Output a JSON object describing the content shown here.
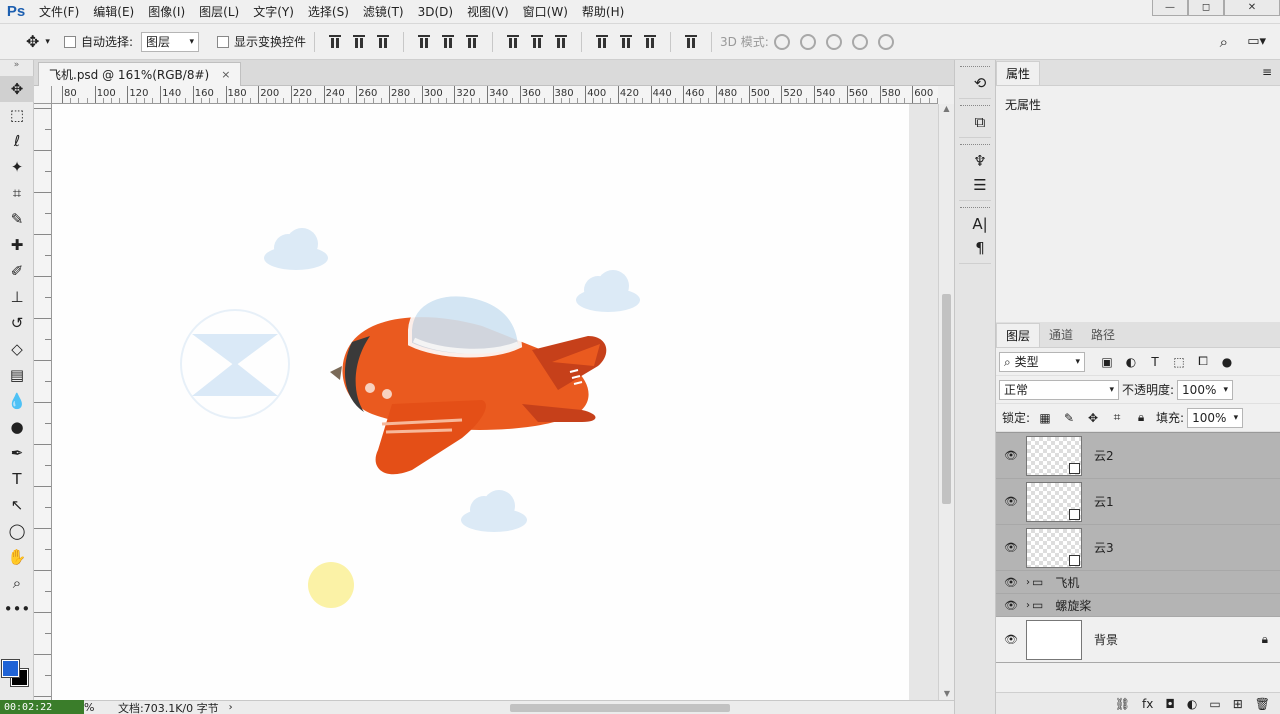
{
  "app": {
    "logo": "Ps"
  },
  "menu": [
    "文件(F)",
    "编辑(E)",
    "图像(I)",
    "图层(L)",
    "文字(Y)",
    "选择(S)",
    "滤镜(T)",
    "3D(D)",
    "视图(V)",
    "窗口(W)",
    "帮助(H)"
  ],
  "window_controls": {
    "minimize": "—",
    "maximize": "◻",
    "close": "✕"
  },
  "options": {
    "auto_select_label": "自动选择:",
    "auto_select_value": "图层",
    "show_transform_label": "显示变换控件",
    "mode_3d_label": "3D 模式:"
  },
  "document": {
    "tab_title": "飞机.psd @ 161%(RGB/8#)",
    "close_glyph": "×"
  },
  "ruler": {
    "h_labels": [
      "80",
      "100",
      "120",
      "140",
      "160",
      "180",
      "200",
      "220",
      "240",
      "260",
      "280",
      "300",
      "320",
      "340",
      "360",
      "380",
      "400",
      "420",
      "440",
      "460",
      "480",
      "500",
      "520",
      "540",
      "560",
      "580",
      "600"
    ]
  },
  "status": {
    "zoom": "161.22%",
    "doc_info": "文档:703.1K/0 字节",
    "timer": "00:02:22"
  },
  "properties_panel": {
    "tab": "属性",
    "empty_text": "无属性"
  },
  "layers_panel": {
    "tabs": [
      "图层",
      "通道",
      "路径"
    ],
    "filter_kind": "类型",
    "blend_mode": "正常",
    "opacity_label": "不透明度:",
    "opacity_value": "100%",
    "lock_label": "锁定:",
    "fill_label": "填充:",
    "fill_value": "100%",
    "layers": [
      {
        "name": "云2",
        "type": "smart",
        "selected": true
      },
      {
        "name": "云1",
        "type": "smart",
        "selected": true
      },
      {
        "name": "云3",
        "type": "smart",
        "selected": true
      },
      {
        "name": "飞机",
        "type": "group",
        "selected": true
      },
      {
        "name": "螺旋桨",
        "type": "group",
        "selected": true
      },
      {
        "name": "背景",
        "type": "background",
        "selected": false
      }
    ]
  },
  "colors": {
    "foreground": "#1f63d6",
    "background": "#000000",
    "plane_orange": "#ea5a1f",
    "plane_dark_orange": "#c6401a",
    "cloud": "#dceaf6",
    "sun": "#fbf2a6"
  }
}
